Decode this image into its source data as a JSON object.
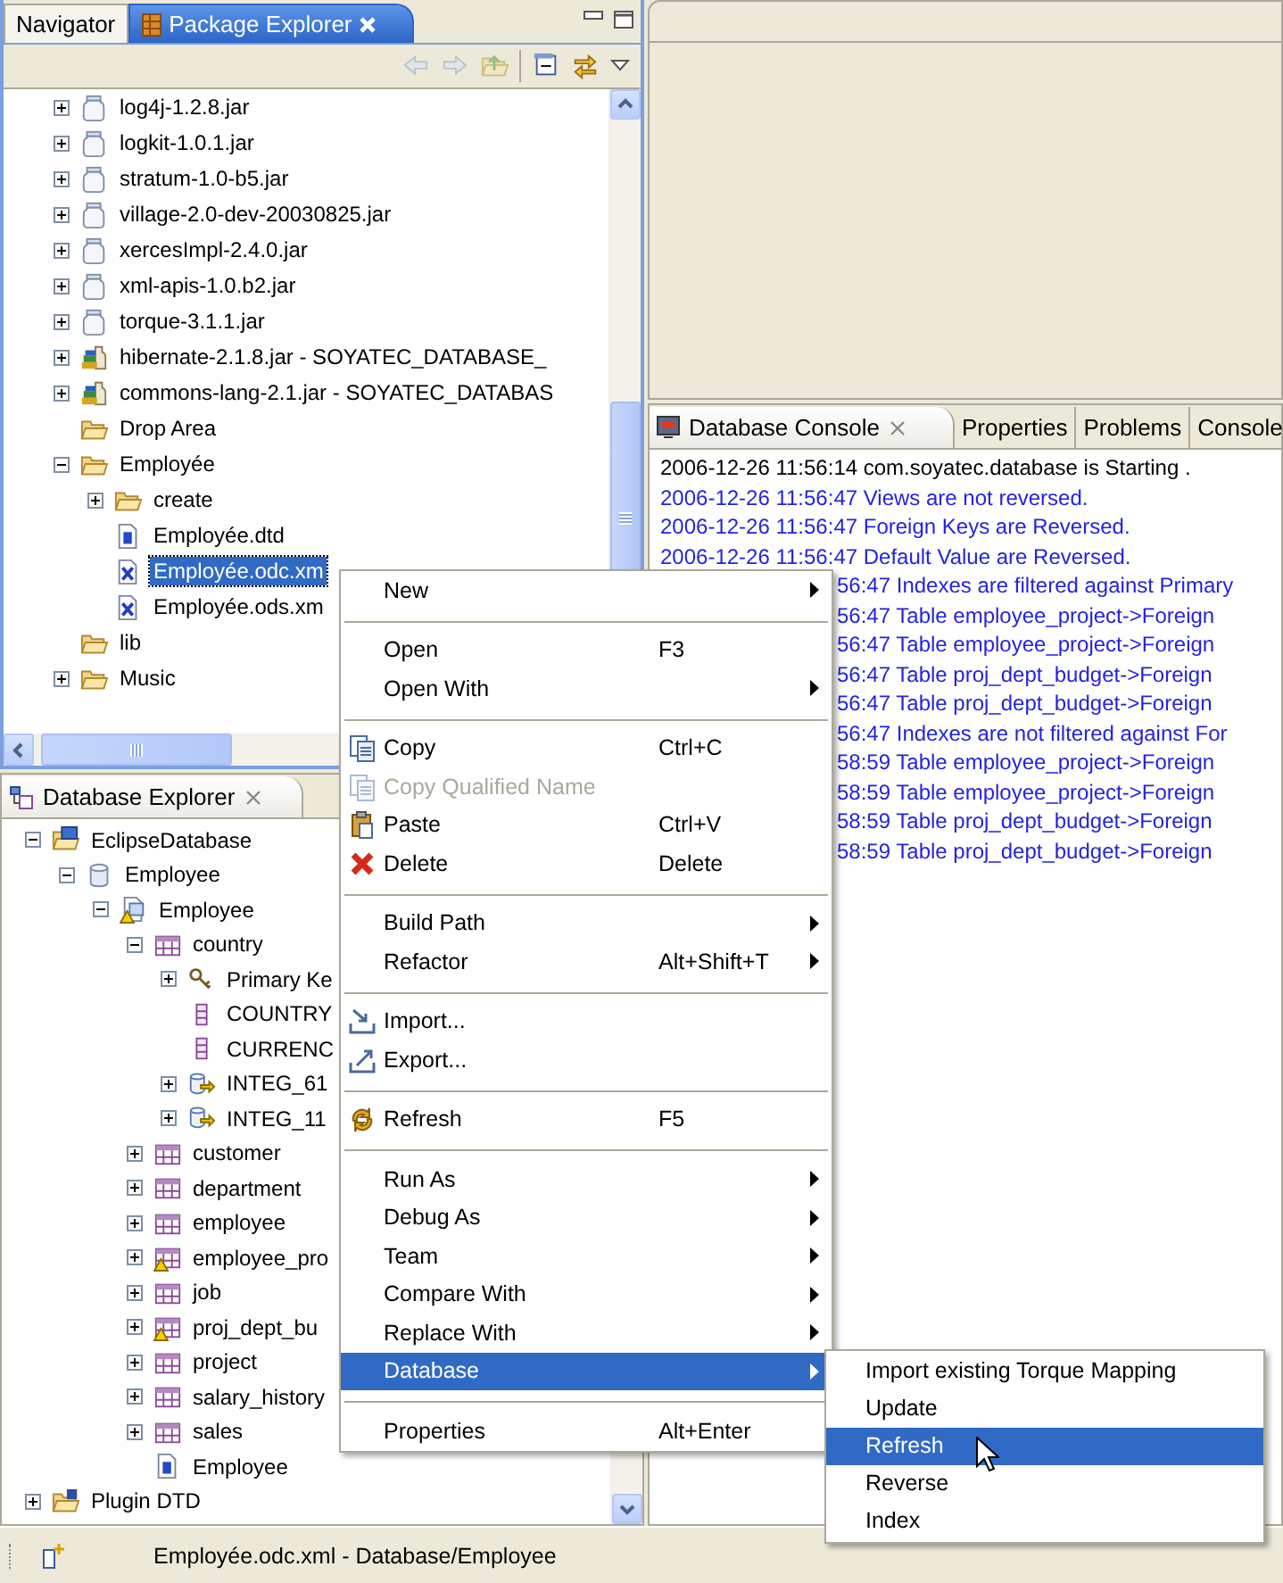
{
  "package_explorer": {
    "active": true,
    "tabs": [
      {
        "label": "Navigator",
        "selected": false
      },
      {
        "label": "Package Explorer",
        "selected": true
      }
    ],
    "toolbar": [
      {
        "kind": "back",
        "disabled": true
      },
      {
        "kind": "forward",
        "disabled": true
      },
      {
        "kind": "up",
        "disabled": true
      },
      {
        "kind": "collapse",
        "disabled": false
      },
      {
        "kind": "link",
        "disabled": false
      }
    ],
    "tree": [
      {
        "label": "log4j-1.2.8.jar",
        "kind": "jar",
        "expanded": false,
        "selected": false
      },
      {
        "label": "logkit-1.0.1.jar",
        "kind": "jar",
        "expanded": false,
        "selected": false
      },
      {
        "label": "stratum-1.0-b5.jar",
        "kind": "jar",
        "expanded": false,
        "selected": false
      },
      {
        "label": "village-2.0-dev-20030825.jar",
        "kind": "jar",
        "expanded": false,
        "selected": false
      },
      {
        "label": "xercesImpl-2.4.0.jar",
        "kind": "jar",
        "expanded": false,
        "selected": false
      },
      {
        "label": "xml-apis-1.0.b2.jar",
        "kind": "jar",
        "expanded": false,
        "selected": false
      },
      {
        "label": "torque-3.1.1.jar",
        "kind": "jar",
        "expanded": false,
        "selected": false
      },
      {
        "label": "hibernate-2.1.8.jar - SOYATEC_DATABASE_",
        "kind": "library",
        "expanded": false,
        "selected": false
      },
      {
        "label": "commons-lang-2.1.jar - SOYATEC_DATABAS",
        "kind": "library",
        "expanded": false,
        "selected": false
      },
      {
        "label": "Drop Area",
        "kind": "folder",
        "selected": false
      },
      {
        "label": "Employée",
        "kind": "folder",
        "expanded": true,
        "selected": false,
        "children": [
          {
            "label": "create",
            "kind": "folder",
            "expanded": false,
            "selected": false
          },
          {
            "label": "Employée.dtd",
            "kind": "dtd",
            "selected": false
          },
          {
            "label": "Employée.odc.xm",
            "kind": "xml",
            "selected": true
          },
          {
            "label": "Employée.ods.xm",
            "kind": "xml",
            "selected": false
          }
        ]
      },
      {
        "label": "lib",
        "kind": "folder",
        "selected": false
      },
      {
        "label": "Music",
        "kind": "folder",
        "expanded": false,
        "selected": false
      }
    ]
  },
  "database_explorer": {
    "active": false,
    "title": "Database Explorer",
    "tree": [
      {
        "label": "EclipseDatabase",
        "kind": "dbfolder",
        "expanded": true,
        "selected": false,
        "children": [
          {
            "label": "Employee",
            "kind": "database",
            "expanded": true,
            "selected": false,
            "children": [
              {
                "label": "Employee",
                "kind": "schema",
                "warning": true,
                "expanded": true,
                "selected": false,
                "children": [
                  {
                    "label": "country",
                    "kind": "table",
                    "warning": false,
                    "expanded": true,
                    "selected": false,
                    "children": [
                      {
                        "label": "Primary Ke",
                        "kind": "key",
                        "expanded": false,
                        "selected": false
                      },
                      {
                        "label": "COUNTRY",
                        "kind": "column",
                        "selected": false
                      },
                      {
                        "label": "CURRENC",
                        "kind": "column",
                        "selected": false
                      },
                      {
                        "label": "INTEG_61",
                        "kind": "fk",
                        "expanded": false,
                        "selected": false
                      },
                      {
                        "label": "INTEG_11",
                        "kind": "fk",
                        "expanded": false,
                        "selected": false
                      }
                    ]
                  },
                  {
                    "label": "customer",
                    "kind": "table",
                    "warning": false,
                    "expanded": false,
                    "selected": false
                  },
                  {
                    "label": "department",
                    "kind": "table",
                    "warning": false,
                    "expanded": false,
                    "selected": false
                  },
                  {
                    "label": "employee",
                    "kind": "table",
                    "warning": false,
                    "expanded": false,
                    "selected": false
                  },
                  {
                    "label": "employee_pro",
                    "kind": "table",
                    "warning": true,
                    "expanded": false,
                    "selected": false
                  },
                  {
                    "label": "job",
                    "kind": "table",
                    "warning": false,
                    "expanded": false,
                    "selected": false
                  },
                  {
                    "label": "proj_dept_bu",
                    "kind": "table",
                    "warning": true,
                    "expanded": false,
                    "selected": false
                  },
                  {
                    "label": "project",
                    "kind": "table",
                    "warning": false,
                    "expanded": false,
                    "selected": false
                  },
                  {
                    "label": "salary_history",
                    "kind": "table",
                    "warning": false,
                    "expanded": false,
                    "selected": false
                  },
                  {
                    "label": "sales",
                    "kind": "table",
                    "warning": false,
                    "expanded": false,
                    "selected": false
                  },
                  {
                    "label": "Employee",
                    "kind": "dtd",
                    "selected": false
                  }
                ]
              }
            ]
          }
        ]
      },
      {
        "label": "Plugin DTD",
        "kind": "plugin",
        "expanded": false,
        "selected": false
      }
    ]
  },
  "console": {
    "active": false,
    "tabs": [
      {
        "label": "Database Console",
        "selected": true
      },
      {
        "label": "Properties",
        "selected": false
      },
      {
        "label": "Problems",
        "selected": false
      },
      {
        "label": "Console",
        "selected": false
      }
    ],
    "lines": [
      {
        "text": "2006-12-26 11:56:14 com.soyatec.database is Starting .",
        "color": "#000000"
      },
      {
        "text": "2006-12-26 11:56:47 Views are not reversed.",
        "color": "#2323e0"
      },
      {
        "text": "2006-12-26 11:56:47 Foreign Keys are Reversed.",
        "color": "#2323e0"
      },
      {
        "text": "2006-12-26 11:56:47 Default Value are Reversed.",
        "color": "#2323e0"
      }
    ],
    "lines_right_of_menu": [
      {
        "text": "56:47 Indexes are filtered against Primary",
        "color": "#2323e0"
      },
      {
        "text": "56:47 Table employee_project->Foreign",
        "color": "#2323e0"
      },
      {
        "text": "56:47 Table employee_project->Foreign",
        "color": "#2323e0"
      },
      {
        "text": "56:47 Table proj_dept_budget->Foreign",
        "color": "#2323e0"
      },
      {
        "text": "56:47 Table proj_dept_budget->Foreign",
        "color": "#2323e0"
      },
      {
        "text": "56:47 Indexes are not filtered against For",
        "color": "#2323e0"
      },
      {
        "text": "58:59 Table employee_project->Foreign",
        "color": "#2323e0"
      },
      {
        "text": "58:59 Table employee_project->Foreign",
        "color": "#2323e0"
      },
      {
        "text": "58:59 Table proj_dept_budget->Foreign",
        "color": "#2323e0"
      },
      {
        "text": "58:59 Table proj_dept_budget->Foreign",
        "color": "#2323e0"
      }
    ]
  },
  "context_menu": {
    "groups": [
      {
        "items": [
          {
            "label": "New",
            "kind": "plain",
            "submenu": true,
            "selected": false,
            "disabled": false
          }
        ]
      },
      {
        "items": [
          {
            "label": "Open",
            "shortcut": "F3",
            "kind": "plain",
            "submenu": false,
            "selected": false,
            "disabled": false
          },
          {
            "label": "Open With",
            "kind": "plain",
            "submenu": true,
            "selected": false,
            "disabled": false
          }
        ]
      },
      {
        "items": [
          {
            "label": "Copy",
            "shortcut": "Ctrl+C",
            "kind": "copy",
            "submenu": false,
            "selected": false,
            "disabled": false
          },
          {
            "label": "Copy Qualified Name",
            "kind": "copy",
            "submenu": false,
            "selected": false,
            "disabled": true
          },
          {
            "label": "Paste",
            "shortcut": "Ctrl+V",
            "kind": "paste",
            "submenu": false,
            "selected": false,
            "disabled": false
          },
          {
            "label": "Delete",
            "shortcut": "Delete",
            "kind": "delete",
            "submenu": false,
            "selected": false,
            "disabled": false
          }
        ]
      },
      {
        "items": [
          {
            "label": "Build Path",
            "kind": "plain",
            "submenu": true,
            "selected": false,
            "disabled": false
          },
          {
            "label": "Refactor",
            "shortcut": "Alt+Shift+T",
            "kind": "plain",
            "submenu": true,
            "selected": false,
            "disabled": false
          }
        ]
      },
      {
        "items": [
          {
            "label": "Import...",
            "kind": "import",
            "submenu": false,
            "selected": false,
            "disabled": false
          },
          {
            "label": "Export...",
            "kind": "export",
            "submenu": false,
            "selected": false,
            "disabled": false
          }
        ]
      },
      {
        "items": [
          {
            "label": "Refresh",
            "shortcut": "F5",
            "kind": "refresh",
            "submenu": false,
            "selected": false,
            "disabled": false
          }
        ]
      },
      {
        "items": [
          {
            "label": "Run As",
            "kind": "plain",
            "submenu": true,
            "selected": false,
            "disabled": false
          },
          {
            "label": "Debug As",
            "kind": "plain",
            "submenu": true,
            "selected": false,
            "disabled": false
          },
          {
            "label": "Team",
            "kind": "plain",
            "submenu": true,
            "selected": false,
            "disabled": false
          },
          {
            "label": "Compare With",
            "kind": "plain",
            "submenu": true,
            "selected": false,
            "disabled": false
          },
          {
            "label": "Replace With",
            "kind": "plain",
            "submenu": true,
            "selected": false,
            "disabled": false
          },
          {
            "label": "Database",
            "kind": "plain",
            "submenu": true,
            "selected": true,
            "disabled": false
          }
        ]
      },
      {
        "items": [
          {
            "label": "Properties",
            "shortcut": "Alt+Enter",
            "kind": "plain",
            "submenu": false,
            "selected": false,
            "disabled": false
          }
        ]
      }
    ]
  },
  "submenu": {
    "items": [
      {
        "label": "Import existing Torque Mapping",
        "selected": false
      },
      {
        "label": "Update",
        "selected": false
      },
      {
        "label": "Refresh",
        "selected": true
      },
      {
        "label": "Reverse",
        "selected": false
      },
      {
        "label": "Index",
        "selected": false
      }
    ]
  },
  "status_bar": {
    "text": "Employée.odc.xml - Database/Employee"
  }
}
